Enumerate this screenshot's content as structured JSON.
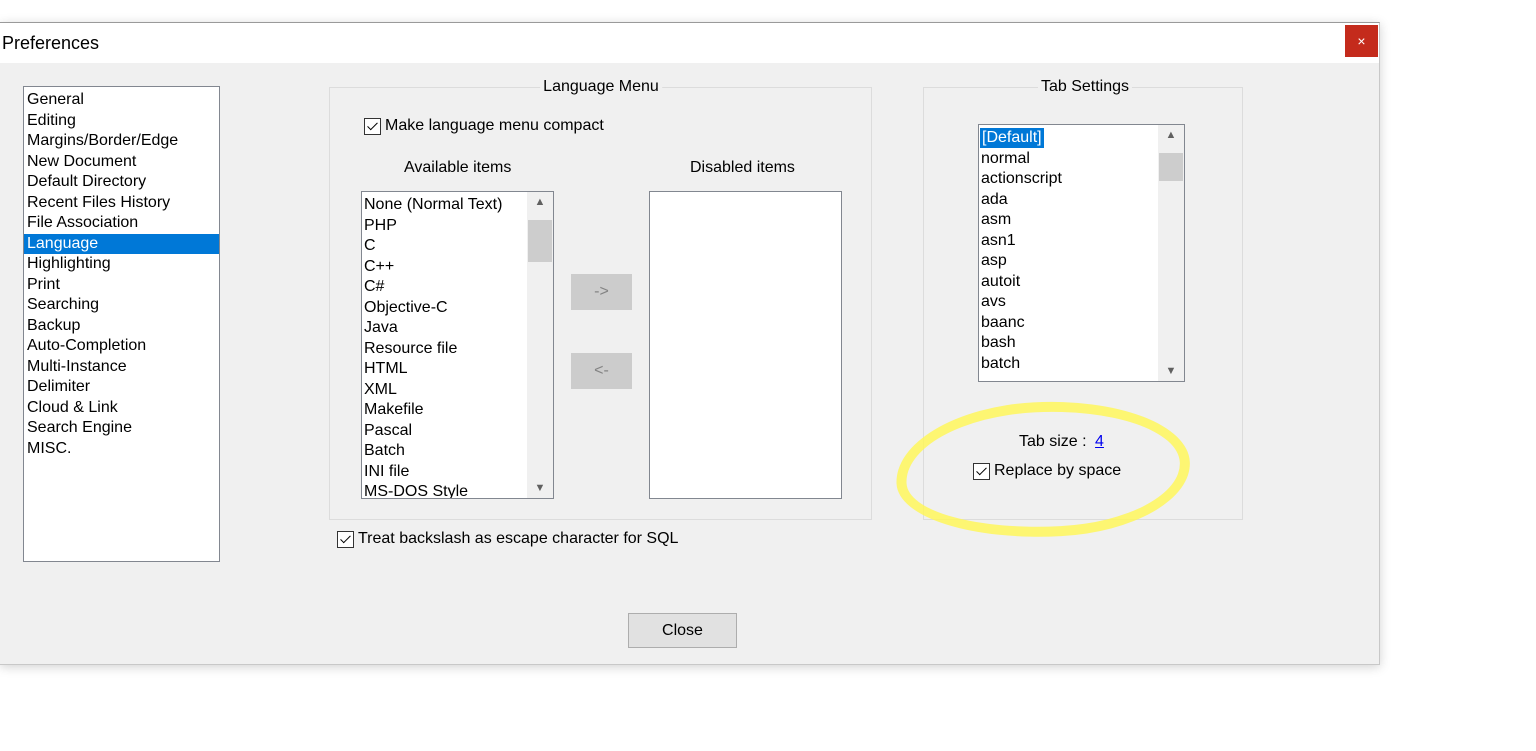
{
  "window": {
    "title": "Preferences",
    "close_glyph": "×"
  },
  "categories": {
    "items": [
      "General",
      "Editing",
      "Margins/Border/Edge",
      "New Document",
      "Default Directory",
      "Recent Files History",
      "File Association",
      "Language",
      "Highlighting",
      "Print",
      "Searching",
      "Backup",
      "Auto-Completion",
      "Multi-Instance",
      "Delimiter",
      "Cloud & Link",
      "Search Engine",
      "MISC."
    ],
    "selected": "Language"
  },
  "language_menu": {
    "title": "Language Menu",
    "compact_label": "Make language menu compact",
    "compact_checked": true,
    "available_header": "Available items",
    "disabled_header": "Disabled items",
    "available_items": [
      "None (Normal Text)",
      "PHP",
      "C",
      "C++",
      "C#",
      "Objective-C",
      "Java",
      "Resource file",
      "HTML",
      "XML",
      "Makefile",
      "Pascal",
      "Batch",
      "INI file",
      "MS-DOS Style"
    ],
    "disabled_items": [],
    "move_right_label": "->",
    "move_left_label": "<-"
  },
  "sql_escape": {
    "label": "Treat backslash as escape character for SQL",
    "checked": true
  },
  "tab_settings": {
    "title": "Tab Settings",
    "languages": [
      "[Default]",
      "normal",
      "actionscript",
      "ada",
      "asm",
      "asn1",
      "asp",
      "autoit",
      "avs",
      "baanc",
      "bash",
      "batch"
    ],
    "selected": "[Default]",
    "tab_size_label": "Tab size :",
    "tab_size_value": "4",
    "replace_label": "Replace by space",
    "replace_checked": true
  },
  "footer": {
    "close_label": "Close"
  },
  "colors": {
    "selection": "#0078d7",
    "close_button": "#c42b1c",
    "highlight": "#fff656"
  },
  "icons": {
    "scroll_up": "▲",
    "scroll_down": "▼"
  }
}
